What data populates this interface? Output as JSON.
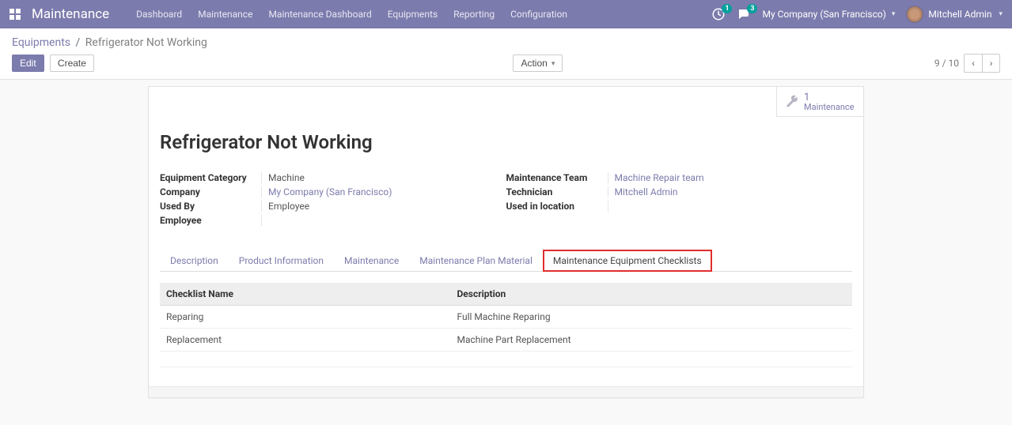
{
  "navbar": {
    "brand": "Maintenance",
    "menu": [
      "Dashboard",
      "Maintenance",
      "Maintenance Dashboard",
      "Equipments",
      "Reporting",
      "Configuration"
    ],
    "activities_badge": "1",
    "messages_badge": "3",
    "company": "My Company (San Francisco)",
    "user": "Mitchell Admin"
  },
  "breadcrumb": {
    "parent": "Equipments",
    "current": "Refrigerator Not Working"
  },
  "buttons": {
    "edit": "Edit",
    "create": "Create",
    "action": "Action"
  },
  "pager": {
    "position": "9",
    "total": "10"
  },
  "stat_button": {
    "count": "1",
    "label": "Maintenance"
  },
  "record": {
    "title": "Refrigerator Not Working",
    "left": {
      "equipment_category": {
        "label": "Equipment Category",
        "value": "Machine"
      },
      "company": {
        "label": "Company",
        "value": "My Company (San Francisco)",
        "link": true
      },
      "used_by": {
        "label": "Used By",
        "value": "Employee"
      },
      "employee": {
        "label": "Employee",
        "value": ""
      }
    },
    "right": {
      "maintenance_team": {
        "label": "Maintenance Team",
        "value": "Machine Repair team",
        "link": true
      },
      "technician": {
        "label": "Technician",
        "value": "Mitchell Admin",
        "link": true
      },
      "used_in_location": {
        "label": "Used in location",
        "value": ""
      }
    }
  },
  "tabs": [
    "Description",
    "Product Information",
    "Maintenance",
    "Maintenance Plan Material",
    "Maintenance Equipment Checklists"
  ],
  "active_tab_index": 4,
  "table": {
    "columns": [
      "Checklist Name",
      "Description"
    ],
    "rows": [
      {
        "name": "Reparing",
        "desc": "Full Machine Reparing"
      },
      {
        "name": "Replacement",
        "desc": "Machine Part Replacement"
      }
    ]
  }
}
